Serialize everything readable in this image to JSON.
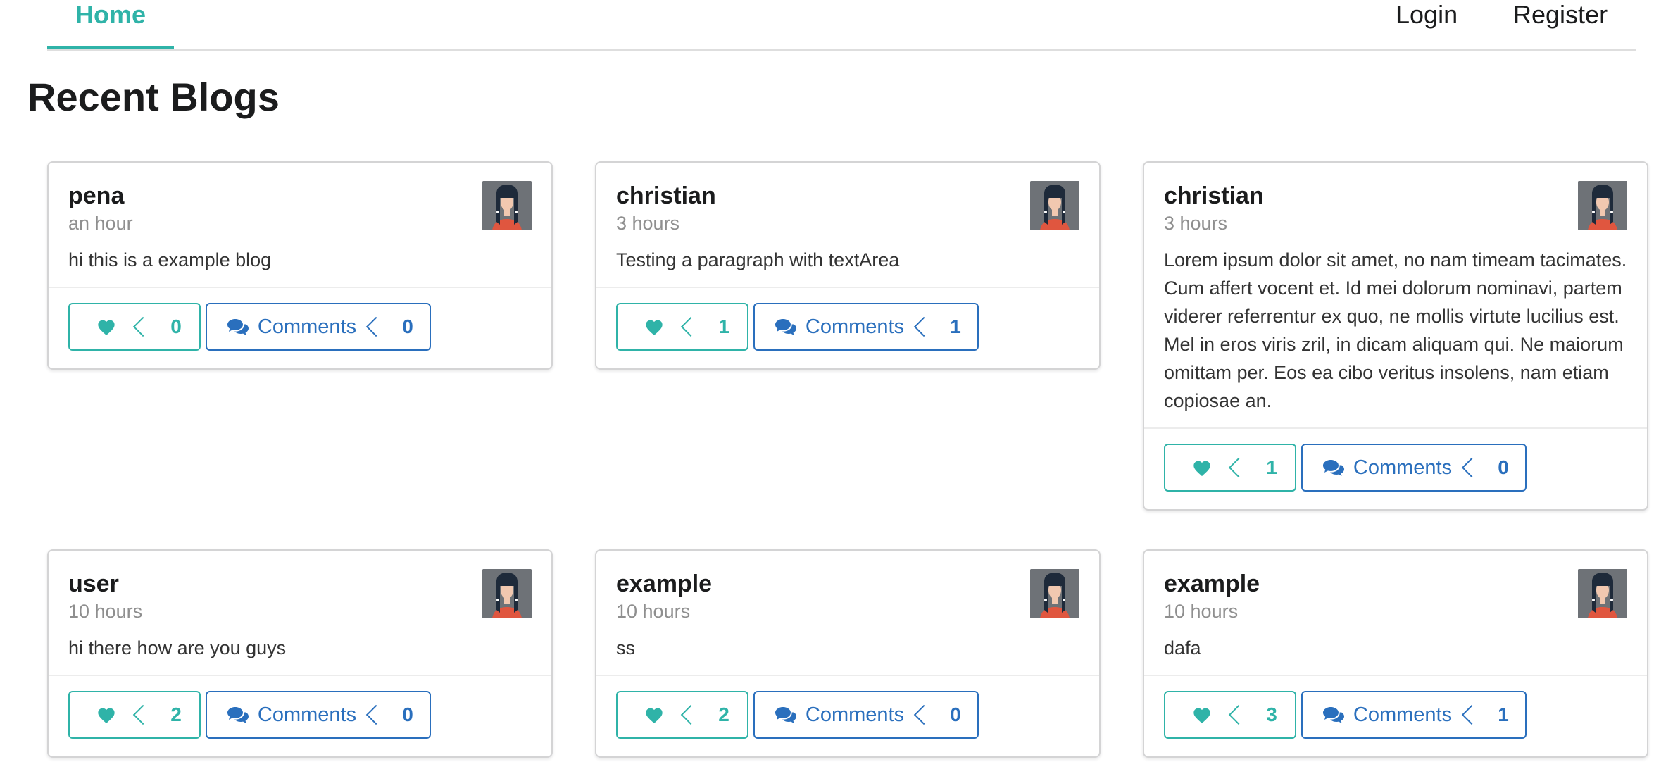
{
  "nav": {
    "home": "Home",
    "login": "Login",
    "register": "Register"
  },
  "page": {
    "title": "Recent Blogs"
  },
  "colors": {
    "like": "#2fb3a8",
    "comment": "#2a6fbd",
    "nav_active": "#2fb3a8"
  },
  "icons": {
    "like": "heart-icon",
    "comment": "comments-icon",
    "avatar": "user-avatar"
  },
  "blogs": [
    {
      "author": "pena",
      "time": "an hour",
      "text": "hi this is a example blog",
      "likes": "0",
      "comments_label": "Comments",
      "comments": "0"
    },
    {
      "author": "christian",
      "time": "3 hours",
      "text": "Testing a paragraph with textArea",
      "likes": "1",
      "comments_label": "Comments",
      "comments": "1"
    },
    {
      "author": "christian",
      "time": "3 hours",
      "text": "Lorem ipsum dolor sit amet, no nam timeam tacimates. Cum affert vocent et. Id mei dolorum nominavi, partem viderer referrentur ex quo, ne mollis virtute lucilius est. Mel in eros viris zril, in dicam aliquam qui. Ne maiorum omittam per. Eos ea cibo veritus insolens, nam etiam copiosae an.",
      "likes": "1",
      "comments_label": "Comments",
      "comments": "0"
    },
    {
      "author": "user",
      "time": "10 hours",
      "text": "hi there how are you guys",
      "likes": "2",
      "comments_label": "Comments",
      "comments": "0"
    },
    {
      "author": "example",
      "time": "10 hours",
      "text": "ss",
      "likes": "2",
      "comments_label": "Comments",
      "comments": "0"
    },
    {
      "author": "example",
      "time": "10 hours",
      "text": "dafa",
      "likes": "3",
      "comments_label": "Comments",
      "comments": "1"
    }
  ]
}
